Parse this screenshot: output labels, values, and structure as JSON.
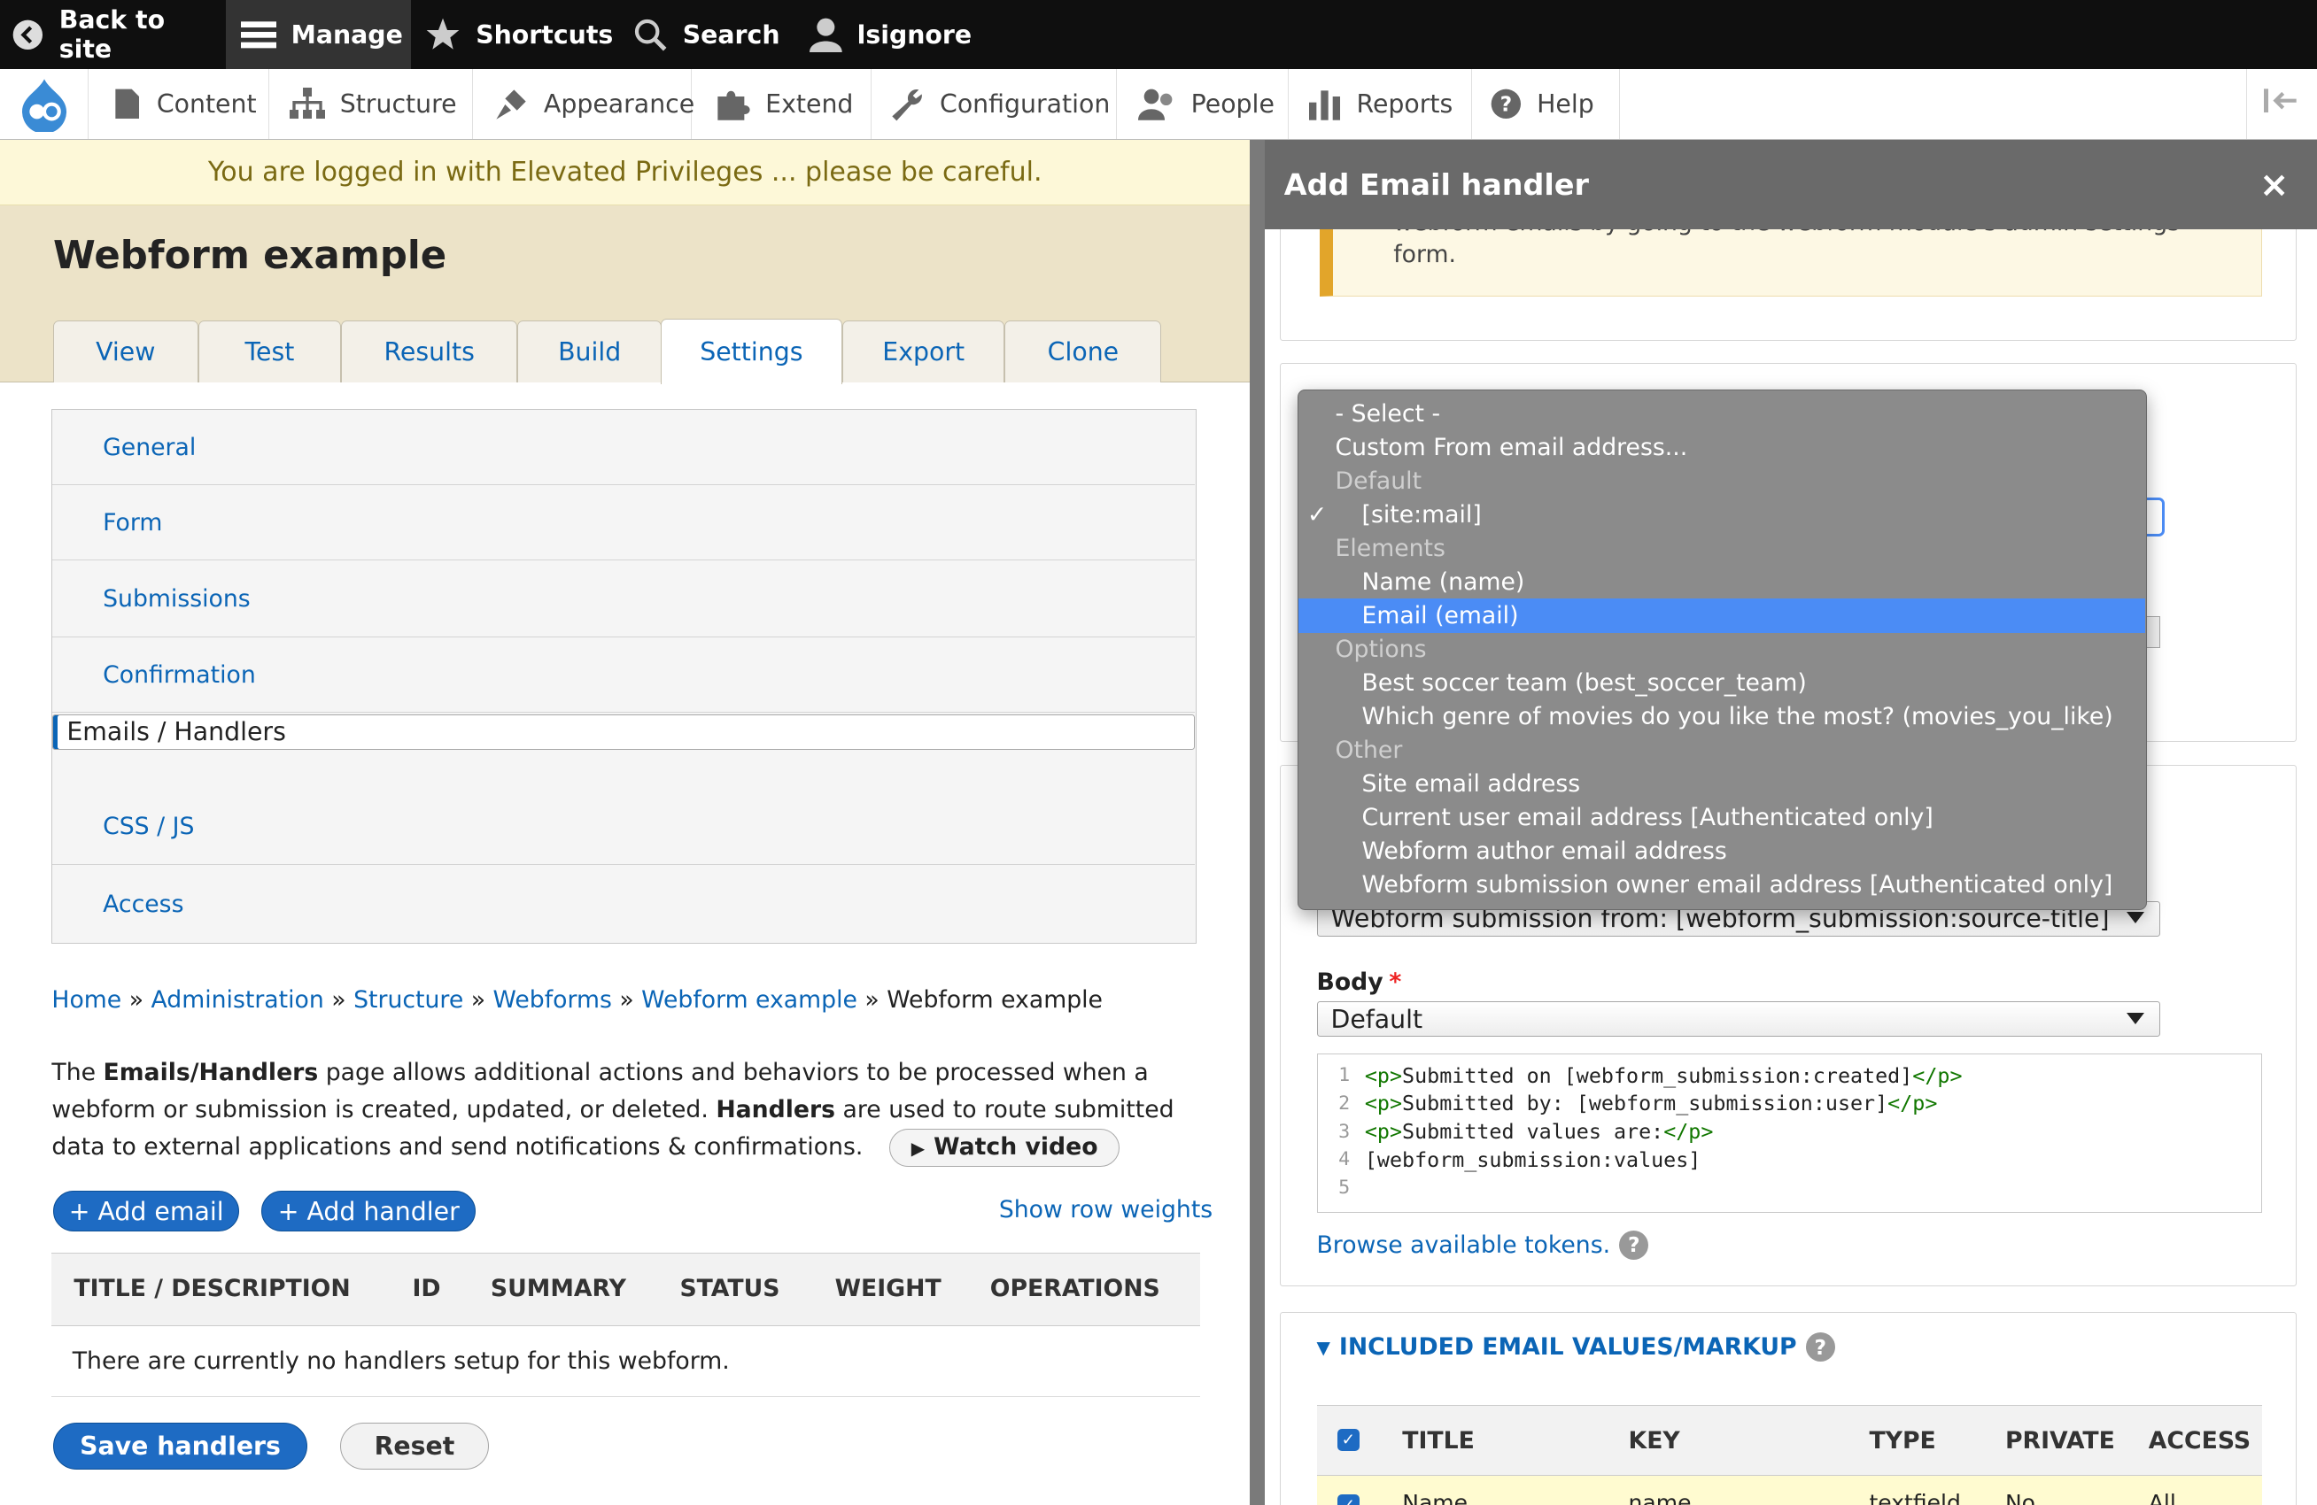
{
  "toolbar": {
    "back": "Back to site",
    "manage": "Manage",
    "shortcuts": "Shortcuts",
    "search": "Search",
    "user": "lsignore"
  },
  "admin_menu": {
    "content": "Content",
    "structure": "Structure",
    "appearance": "Appearance",
    "extend": "Extend",
    "configuration": "Configuration",
    "people": "People",
    "reports": "Reports",
    "help": "Help"
  },
  "warning": "You are logged in with Elevated Privileges ... please be careful.",
  "page": {
    "title": "Webform example",
    "tabs": [
      "View",
      "Test",
      "Results",
      "Build",
      "Settings",
      "Export",
      "Clone"
    ],
    "active_tab": "Settings",
    "vtabs": [
      "General",
      "Form",
      "Submissions",
      "Confirmation",
      "Emails / Handlers",
      "CSS / JS",
      "Access"
    ],
    "active_vtab": "Emails / Handlers",
    "breadcrumb": {
      "home": "Home",
      "administration": "Administration",
      "structure": "Structure",
      "webforms": "Webforms",
      "webform_example": "Webform example",
      "current": "Webform example",
      "sep": "»"
    },
    "description": {
      "p1": "The ",
      "b1": "Emails/Handlers",
      "p2": " page allows additional actions and behaviors to be processed when a webform or submission is created, updated, or deleted. ",
      "b2": "Handlers",
      "p3": " are used to route submitted data to external applications and send notifications & confirmations."
    },
    "watch_video": "Watch video",
    "add_email": "+ Add email",
    "add_handler": "+ Add handler",
    "show_row_weights": "Show row weights",
    "table_headers": [
      "TITLE / DESCRIPTION",
      "ID",
      "SUMMARY",
      "STATUS",
      "WEIGHT",
      "OPERATIONS"
    ],
    "empty_message": "There are currently no handlers setup for this webform.",
    "save_handlers": "Save handlers",
    "reset": "Reset"
  },
  "dialog": {
    "title": "Add Email handler",
    "close": "×",
    "note_line1": "webform emails by going to the webform module's admin settings",
    "note_line2": "form.",
    "subject_select": "Webform submission from: [webform_submission:source-title]",
    "body_label": "Body",
    "body_required": "*",
    "body_select": "Default",
    "code_lines": [
      {
        "n": "1",
        "open": "<p>",
        "text": "Submitted on [webform_submission:created]",
        "close": "</p>"
      },
      {
        "n": "2",
        "open": "<p>",
        "text": "Submitted by: [webform_submission:user]",
        "close": "</p>"
      },
      {
        "n": "3",
        "open": "<p>",
        "text": "Submitted values are:",
        "close": "</p>"
      },
      {
        "n": "4",
        "open": "",
        "text": "[webform_submission:values]",
        "close": ""
      },
      {
        "n": "5",
        "open": "",
        "text": "",
        "close": ""
      }
    ],
    "browse_tokens": "Browse available tokens.",
    "help_mark": "?",
    "included_title": "INCLUDED EMAIL VALUES/MARKUP",
    "included_headers": [
      "TITLE",
      "KEY",
      "TYPE",
      "PRIVATE",
      "ACCESS"
    ],
    "included_row": [
      "Name",
      "name",
      "textfield",
      "No",
      "All"
    ]
  },
  "dropdown": {
    "items": [
      {
        "type": "top",
        "label": "- Select -"
      },
      {
        "type": "top",
        "label": "Custom From email address..."
      },
      {
        "type": "group",
        "label": "Default"
      },
      {
        "type": "opt",
        "label": "[site:mail]",
        "checked": true
      },
      {
        "type": "group",
        "label": "Elements"
      },
      {
        "type": "opt",
        "label": "Name (name)"
      },
      {
        "type": "opt",
        "label": "Email (email)",
        "highlighted": true
      },
      {
        "type": "group",
        "label": "Options"
      },
      {
        "type": "opt",
        "label": "Best soccer team (best_soccer_team)"
      },
      {
        "type": "opt",
        "label": "Which genre of movies do you like the most? (movies_you_like)"
      },
      {
        "type": "group",
        "label": "Other"
      },
      {
        "type": "opt",
        "label": "Site email address"
      },
      {
        "type": "opt",
        "label": "Current user email address [Authenticated only]"
      },
      {
        "type": "opt",
        "label": "Webform author email address"
      },
      {
        "type": "opt",
        "label": "Webform submission owner email address [Authenticated only]"
      }
    ],
    "checkmark": "✓"
  },
  "colors": {
    "link": "#0b65b6",
    "button": "#1e6bc3",
    "highlight": "#4b8cf5",
    "toolbar": "#0f0f0f"
  }
}
